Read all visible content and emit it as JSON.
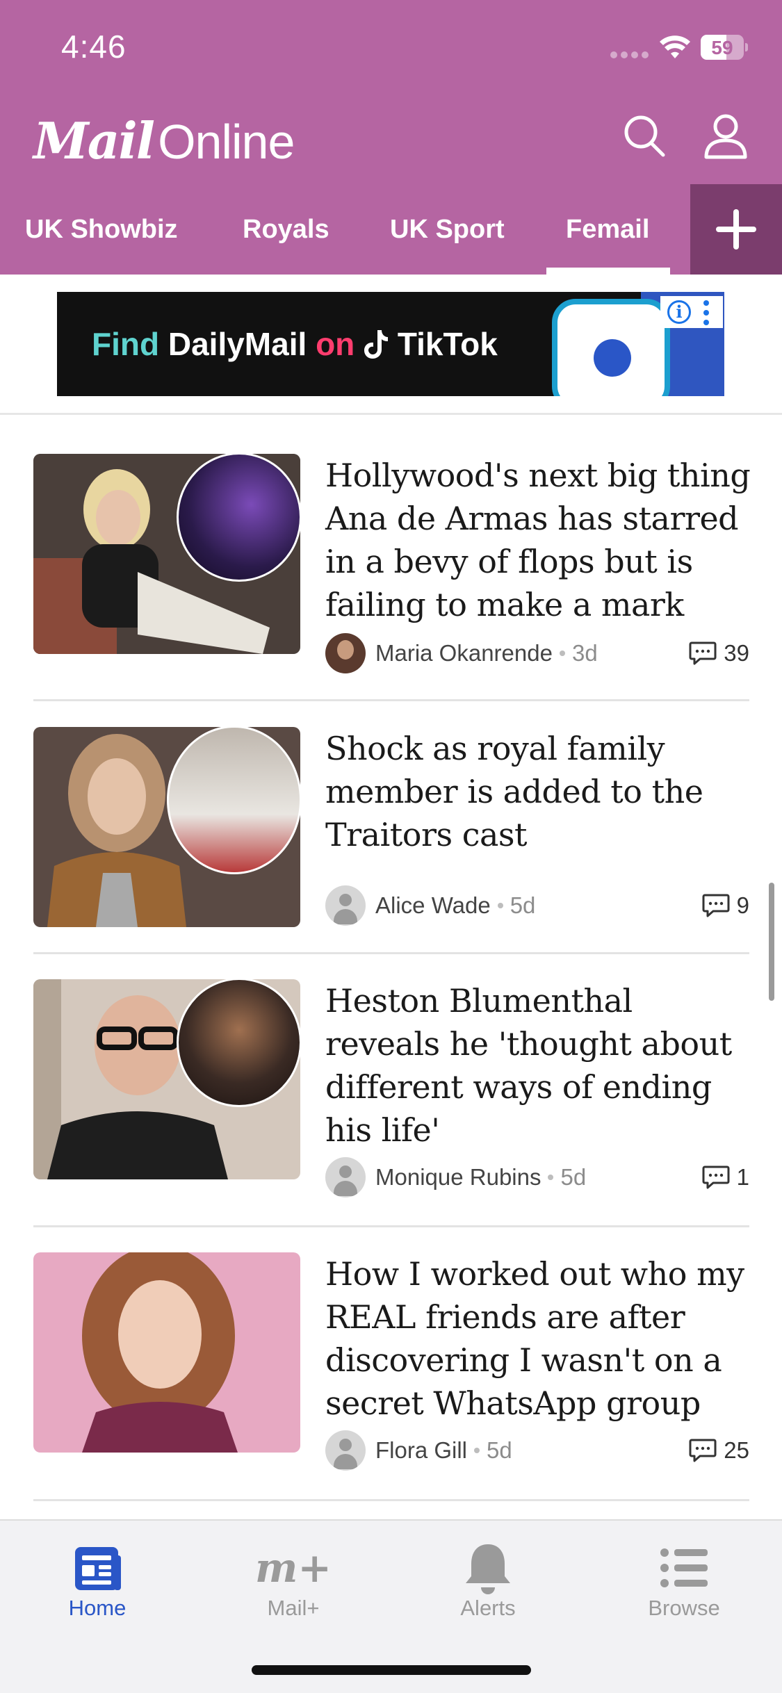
{
  "status_bar": {
    "time": "4:46",
    "battery_percent": "59",
    "battery_level": 0.59
  },
  "header": {
    "logo_mail": "Mail",
    "logo_online": "Online",
    "colors": {
      "header_bg": "#b565a2",
      "add_tab_bg": "#7b3d6d"
    }
  },
  "tabs": [
    {
      "label": "UK Showbiz",
      "active": false
    },
    {
      "label": "Royals",
      "active": false
    },
    {
      "label": "UK Sport",
      "active": false
    },
    {
      "label": "Femail",
      "active": true
    }
  ],
  "ad": {
    "find": "Find",
    "brand": "DailyMail",
    "on": "on",
    "platform": "TikTok",
    "info_icon": "info-icon"
  },
  "articles": [
    {
      "headline": "Hollywood's next big thing Ana de Armas has starred in a bevy of flops but is failing to make a mark",
      "author": "Maria Okanrende",
      "age": "3d",
      "comments": "39"
    },
    {
      "headline": "Shock as royal family member is added to the Traitors cast",
      "author": "Alice Wade",
      "age": "5d",
      "comments": "9"
    },
    {
      "headline": "Heston Blumenthal reveals he 'thought about different ways of ending his life'",
      "author": "Monique Rubins",
      "age": "5d",
      "comments": "1"
    },
    {
      "headline": "How I worked out who my REAL friends are after discovering I wasn't on a secret WhatsApp group",
      "author": "Flora Gill",
      "age": "5d",
      "comments": "25"
    }
  ],
  "bottom_nav": [
    {
      "label": "Home",
      "icon": "newspaper-icon",
      "active": true
    },
    {
      "label": "Mail+",
      "icon": "mail-plus-icon",
      "active": false
    },
    {
      "label": "Alerts",
      "icon": "bell-icon",
      "active": false
    },
    {
      "label": "Browse",
      "icon": "list-icon",
      "active": false
    }
  ],
  "colors": {
    "accent_active": "#2a56c7",
    "inactive": "#9a9a9a"
  }
}
